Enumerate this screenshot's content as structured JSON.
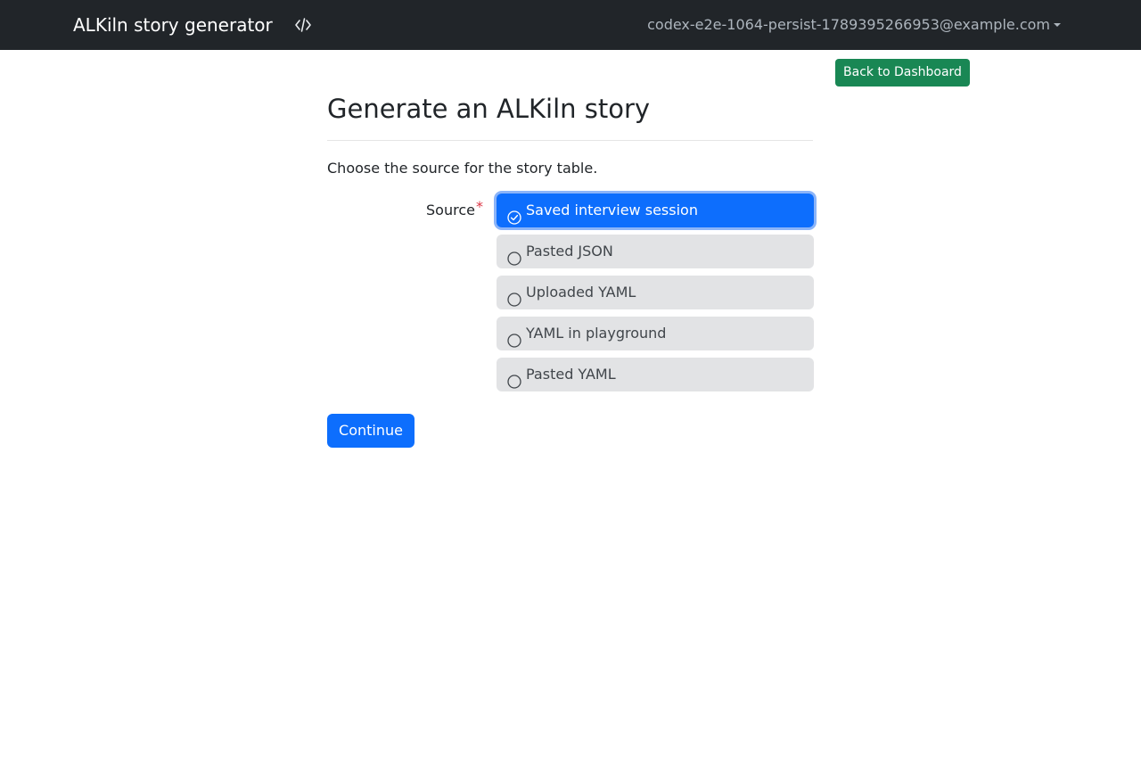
{
  "navbar": {
    "brand": "ALKiln story generator",
    "code_icon": "code-icon",
    "user_email": "codex-e2e-1064-persist-1789395266953@example.com",
    "background": "#212529"
  },
  "actions": {
    "back_label": "Back to Dashboard",
    "back_color": "#198754"
  },
  "main": {
    "title": "Generate an ALKiln story",
    "intro": "Choose the source for the story table.",
    "field_label": "Source",
    "required_mark": "*",
    "options": [
      {
        "label": "Saved interview session",
        "selected": true
      },
      {
        "label": "Pasted JSON",
        "selected": false
      },
      {
        "label": "Uploaded YAML",
        "selected": false
      },
      {
        "label": "YAML in playground",
        "selected": false
      },
      {
        "label": "Pasted YAML",
        "selected": false
      }
    ],
    "continue_label": "Continue"
  },
  "colors": {
    "primary": "#0d6efd",
    "option_bg": "#e2e3e5",
    "required": "#dc3545"
  }
}
